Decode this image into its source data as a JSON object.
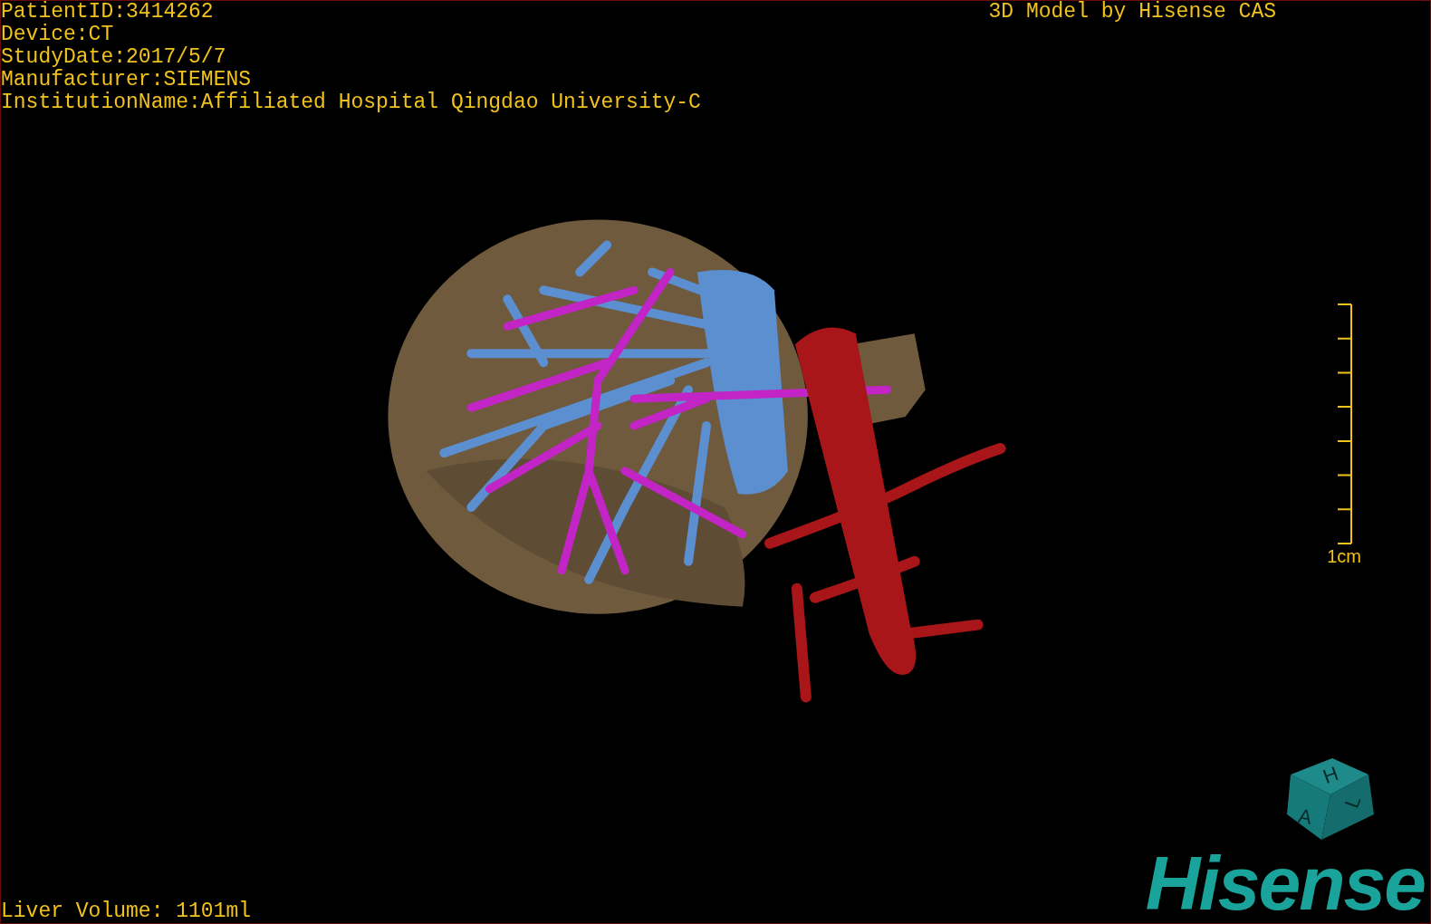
{
  "patient_info": [
    "PatientID:3414262",
    "Device:CT",
    "StudyDate:2017/5/7",
    "Manufacturer:SIEMENS",
    "InstitutionName:Affiliated Hospital Qingdao University-C"
  ],
  "credit": "3D Model by Hisense CAS",
  "scale_bar": {
    "label": "1cm"
  },
  "orientation_cube": {
    "faces": [
      "H",
      "A",
      "L"
    ]
  },
  "liver_volume": "Liver Volume: 1101ml",
  "logo": "Hisense"
}
